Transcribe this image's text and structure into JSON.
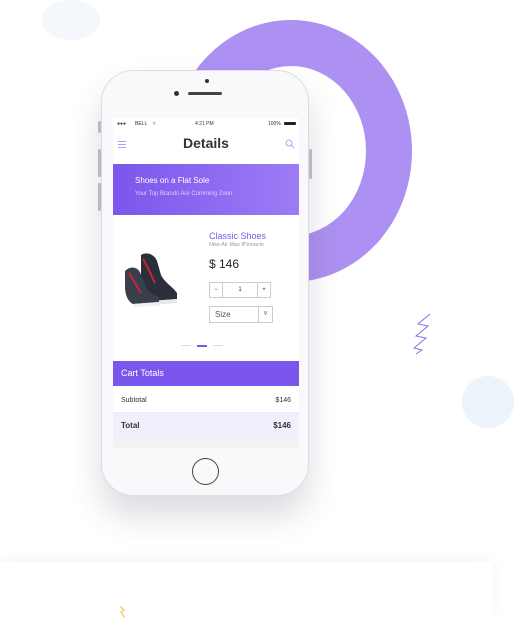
{
  "phone": {
    "status": {
      "carrier": "BELL",
      "time": "4:21 PM",
      "battery": "100%"
    },
    "header": {
      "title": "Details"
    },
    "banner": {
      "title": "Shoes on a Flat Sole",
      "subtitle": "Your Top Brands Are Comming Zoon"
    },
    "product": {
      "name": "Classic Shoes",
      "subtitle": "Nike Air Max IPinnacle",
      "price": "$ 146",
      "quantity": "1",
      "size_placeholder": "Size"
    },
    "cart": {
      "title": "Cart Totals",
      "rows": [
        {
          "label": "Subtotal",
          "value": "$146"
        },
        {
          "label": "Total",
          "value": "$146"
        }
      ]
    }
  },
  "colors": {
    "accent": "#7b56ec",
    "ring": "#a98bf1"
  },
  "icons": [
    "menu-icon",
    "search-icon",
    "minus-icon",
    "plus-icon",
    "chevron-down-icon",
    "wifi-icon",
    "battery-icon"
  ]
}
